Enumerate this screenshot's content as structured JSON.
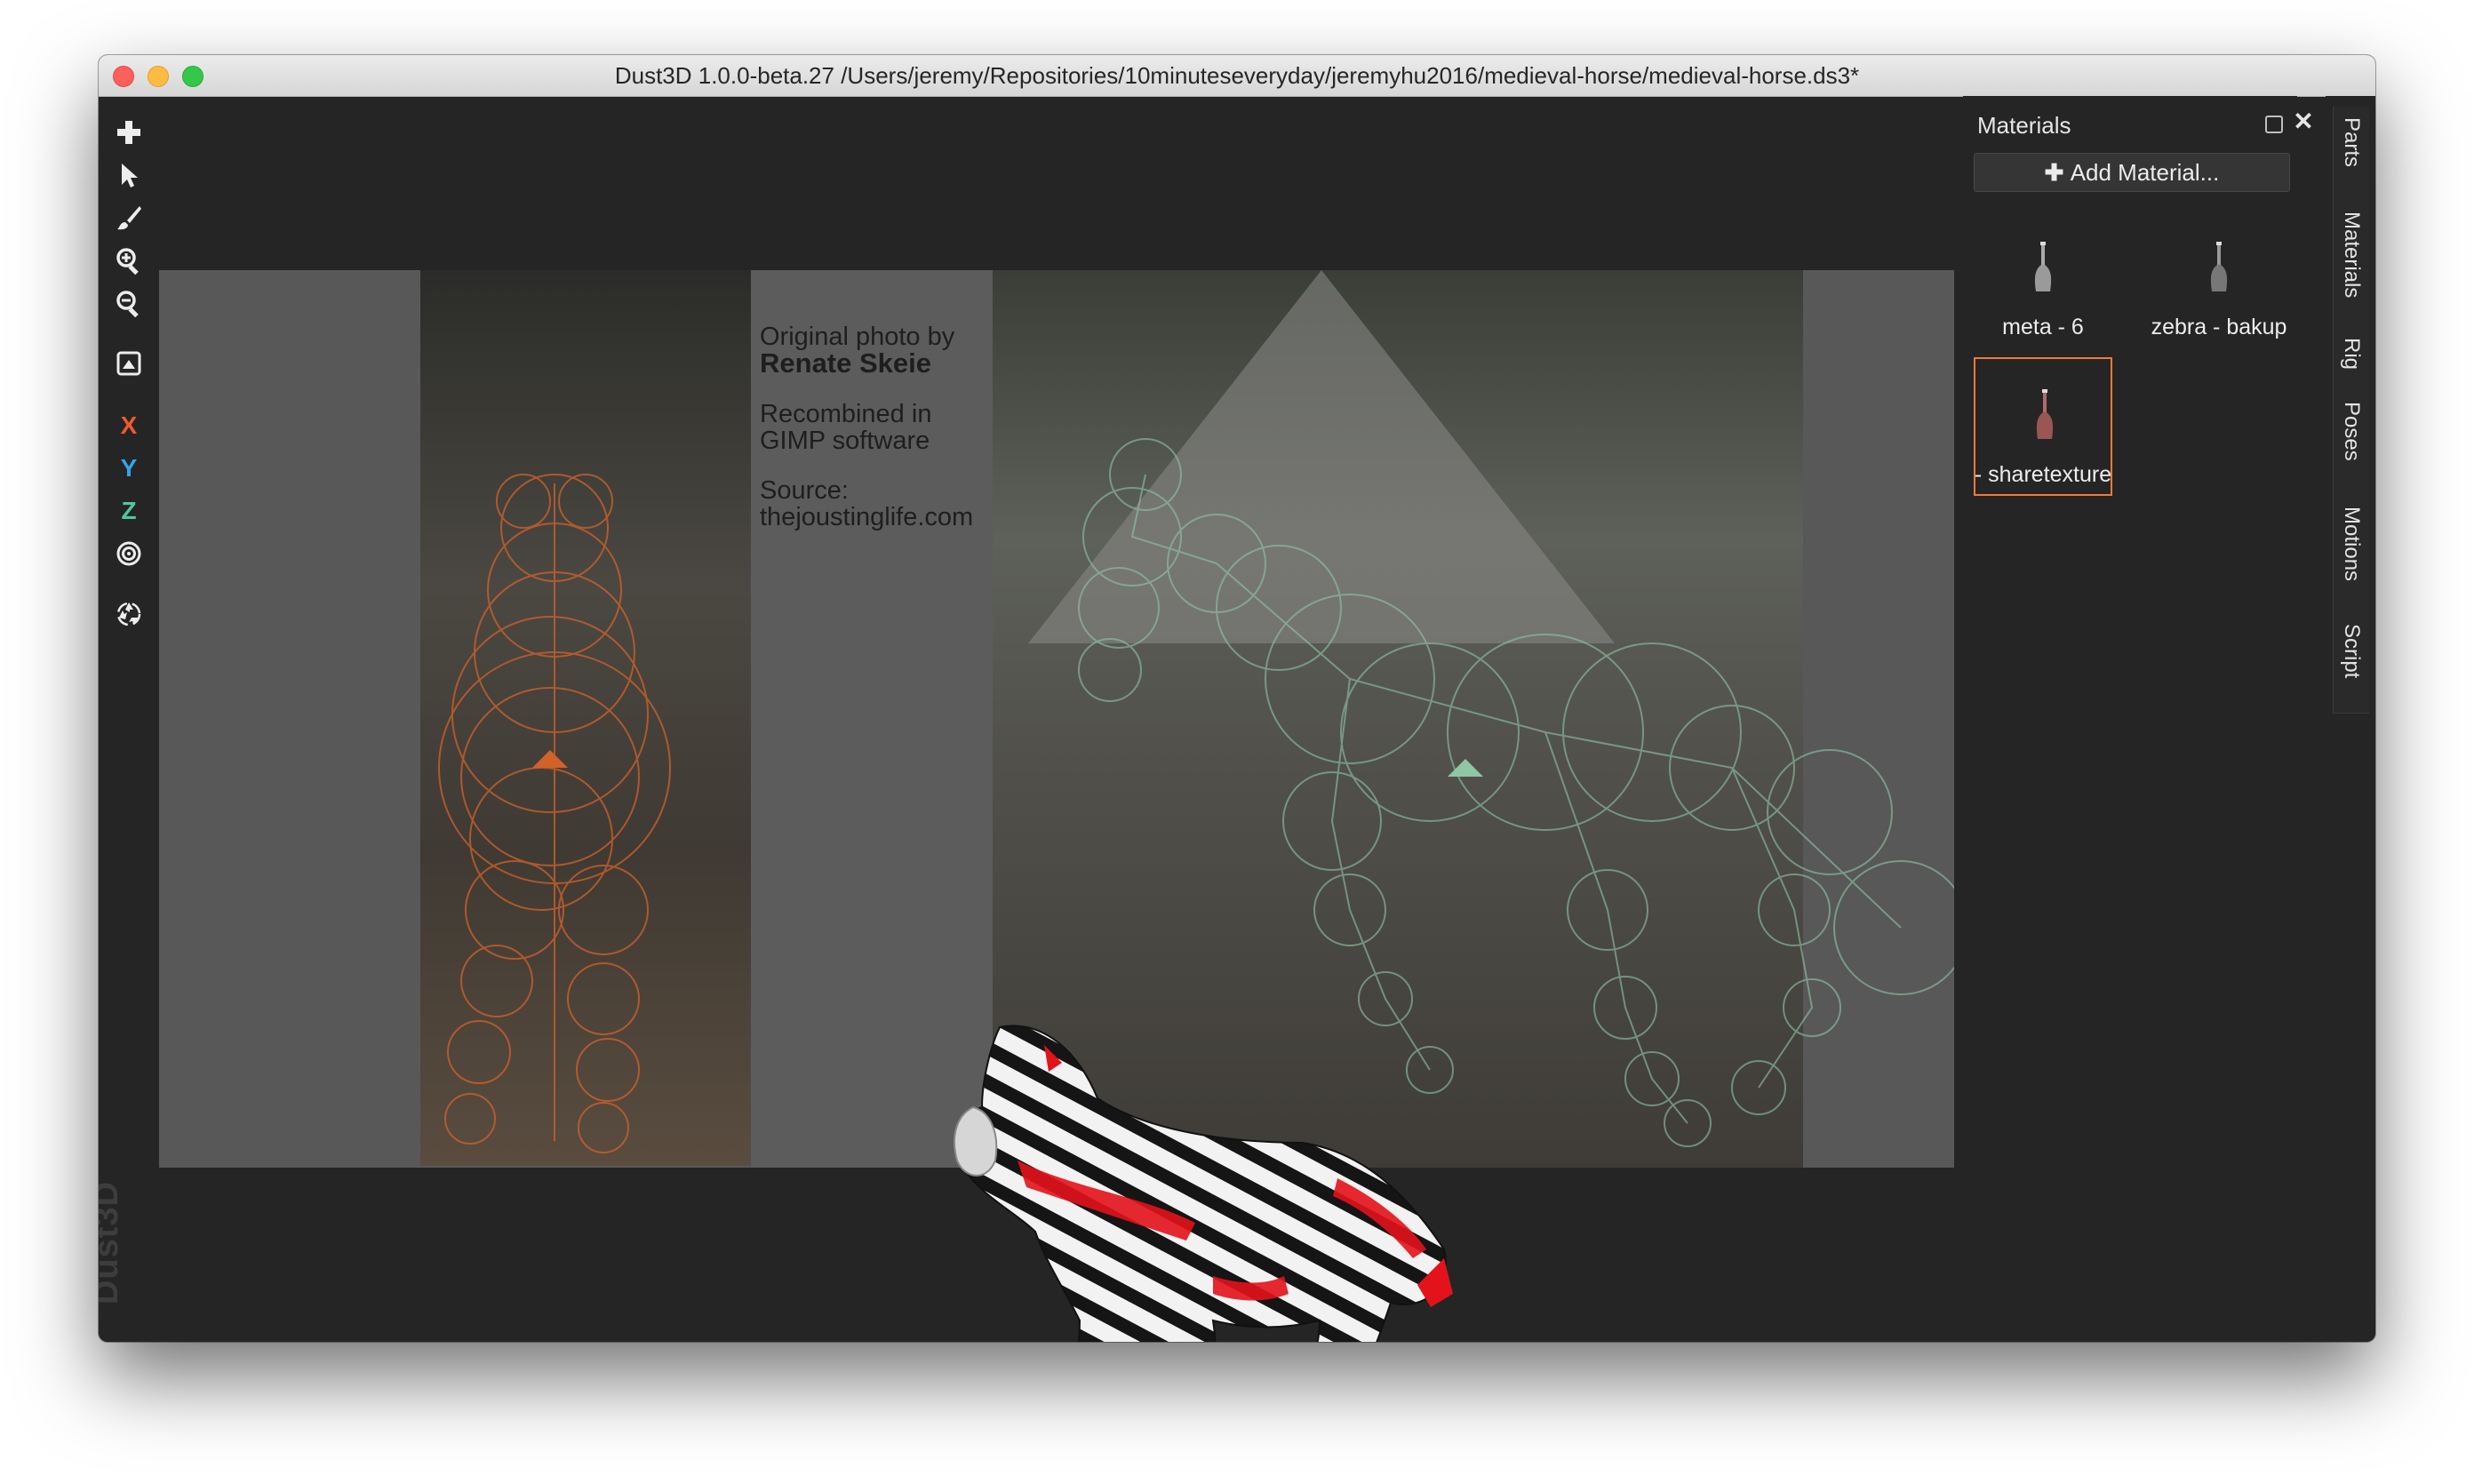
{
  "window": {
    "title": "Dust3D 1.0.0-beta.27 /Users/jeremy/Repositories/10minuteseveryday/jeremyhu2016/medieval-horse/medieval-horse.ds3*"
  },
  "toolbar": {
    "tools": [
      {
        "name": "add-icon"
      },
      {
        "name": "select-icon"
      },
      {
        "name": "paint-brush-icon"
      },
      {
        "name": "zoom-in-icon"
      },
      {
        "name": "zoom-out-icon"
      },
      {
        "name": "camera-icon"
      },
      {
        "name": "axis-x",
        "label": "X",
        "color": "#ee5a2c"
      },
      {
        "name": "axis-y",
        "label": "Y",
        "color": "#35a3ea"
      },
      {
        "name": "axis-z",
        "label": "Z",
        "color": "#4fc7a2"
      },
      {
        "name": "radial-icon"
      },
      {
        "name": "recycle-icon"
      }
    ],
    "logo": "Dust3D"
  },
  "reference_image": {
    "note_line1": "Original photo by",
    "note_author": "Renate Skeie",
    "note_line3": "Recombined in",
    "note_line4": "GIMP software",
    "note_line5": "Source:",
    "note_line6": "thejoustinglife.com"
  },
  "materials_panel": {
    "title": "Materials",
    "add_button": "Add Material...",
    "items": [
      {
        "label": "meta - 6",
        "selected": false
      },
      {
        "label": "zebra - bakup",
        "selected": false
      },
      {
        "label": "- sharetexture",
        "selected": true
      }
    ]
  },
  "side_tabs": [
    "Parts",
    "Materials",
    "Rig",
    "Poses",
    "Motions",
    "Script"
  ],
  "colors": {
    "accent_orange": "#f07a3c",
    "node_green": "#8fc6a6",
    "node_orange": "#d2622a",
    "zebra_red": "#e3121b"
  }
}
